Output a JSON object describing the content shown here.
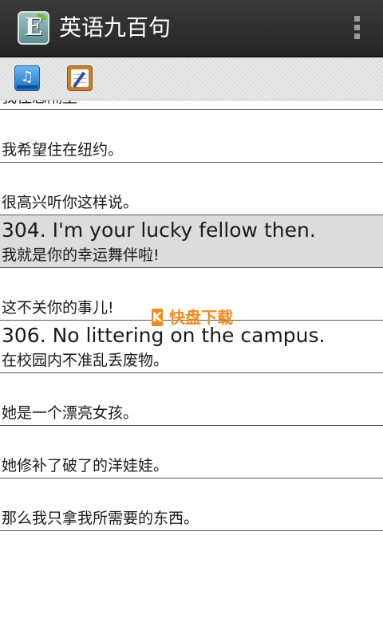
{
  "app": {
    "title": "英语九百句",
    "icon_letter": "E"
  },
  "toolbar": {
    "music_icon": "music-book-icon",
    "notes_icon": "notepad-icon"
  },
  "list": {
    "rows": [
      {
        "en": "",
        "cn": "我住您隔壁"
      },
      {
        "en": "",
        "cn": "我希望住在纽约。"
      },
      {
        "en": "",
        "cn": "很高兴听你这样说。"
      },
      {
        "en": "304. I'm your lucky fellow then.",
        "cn": "我就是你的幸运舞伴啦!"
      },
      {
        "en": "",
        "cn": "这不关你的事儿!"
      },
      {
        "en": "306. No littering on the campus.",
        "cn": "在校园内不准乱丢废物。"
      },
      {
        "en": "",
        "cn": "她是一个漂亮女孩。"
      },
      {
        "en": "",
        "cn": "她修补了破了的洋娃娃。"
      },
      {
        "en": "",
        "cn": "那么我只拿我所需要的东西。"
      }
    ]
  },
  "watermark": {
    "k": "K",
    "text": "快盘下载"
  },
  "colors": {
    "action_bar": "#2f2f2f",
    "highlight_row": "#dcdcdc",
    "watermark": "#f08a1c"
  }
}
